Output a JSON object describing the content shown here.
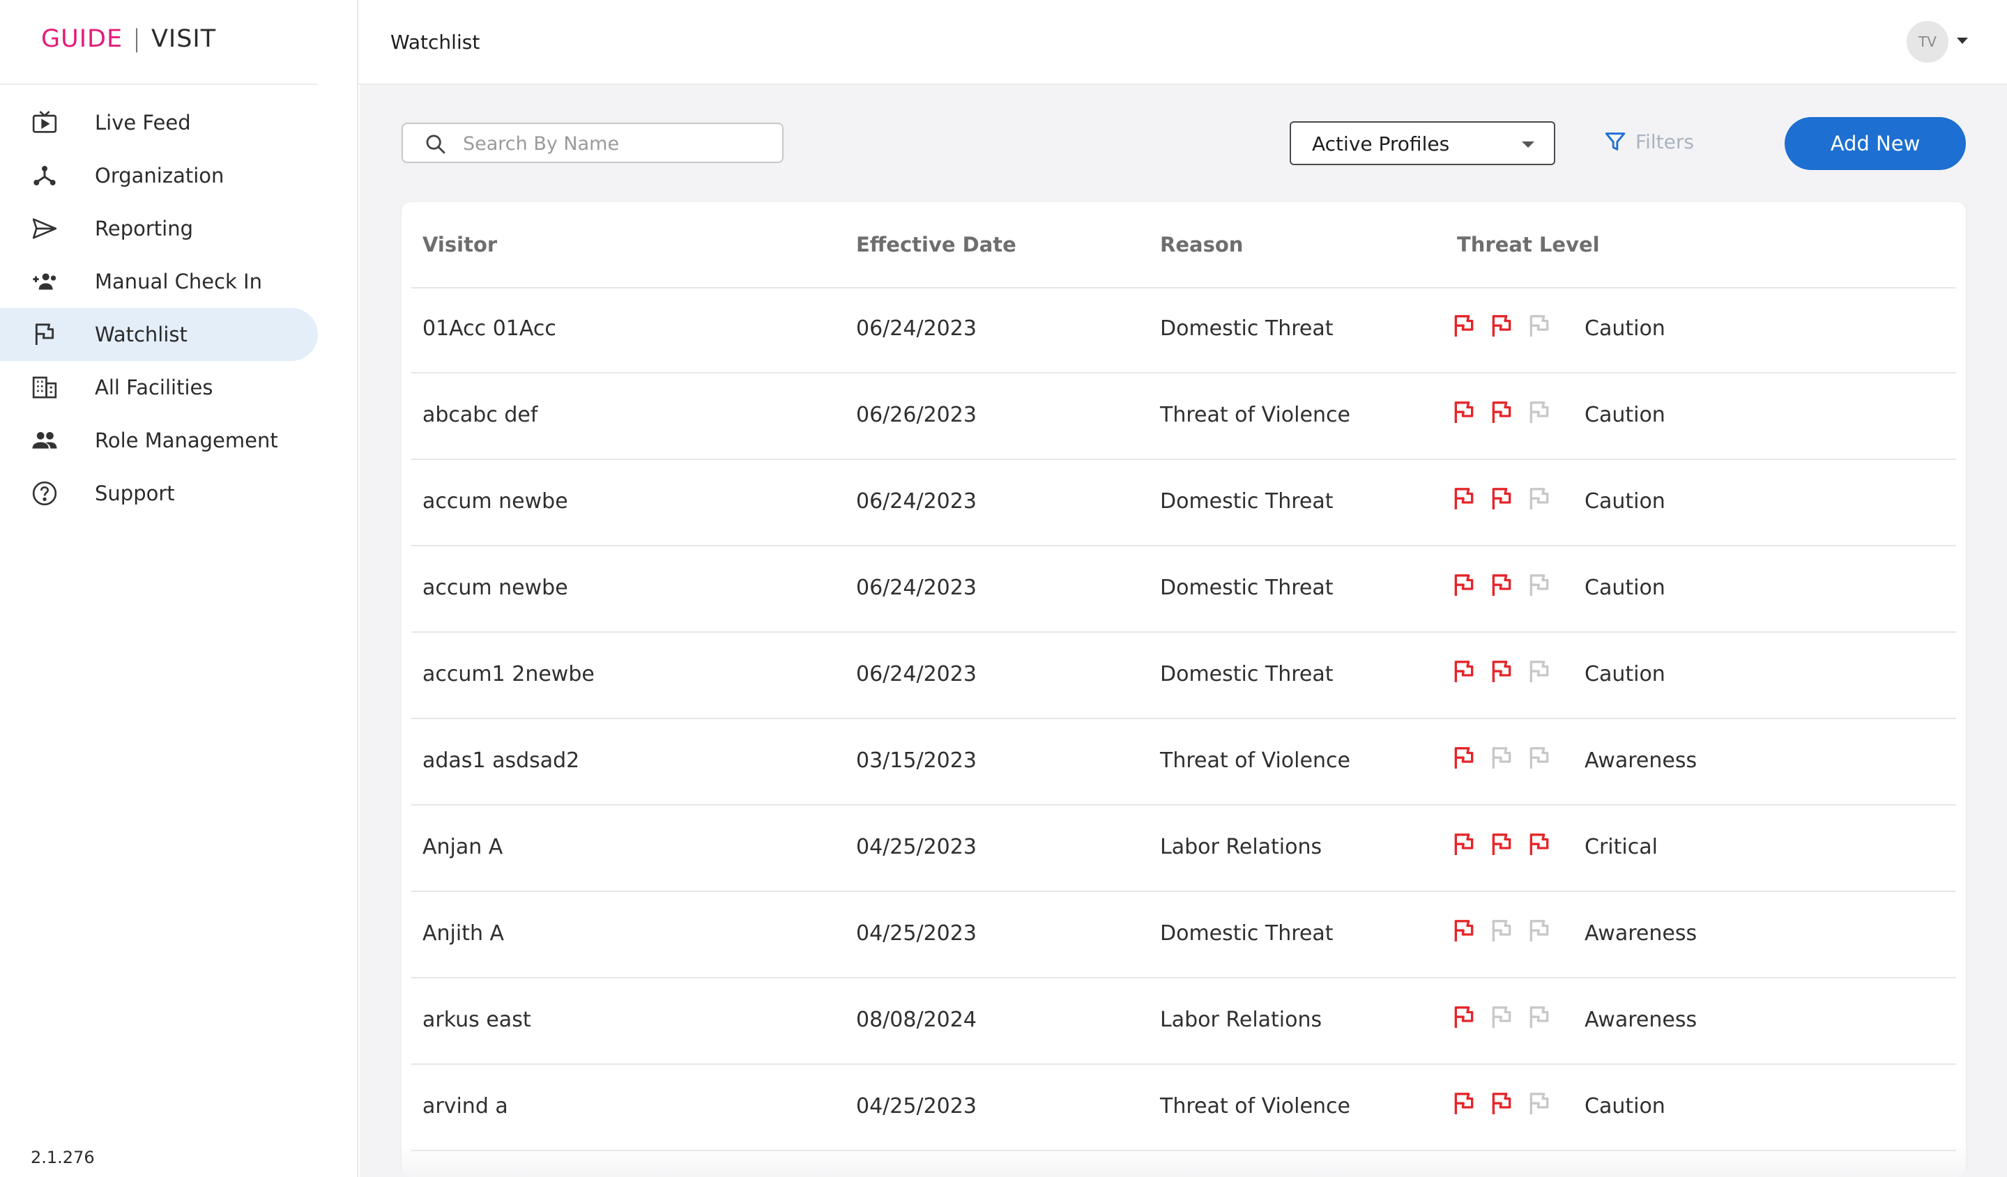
{
  "app": {
    "logo_left": "GUIDE",
    "logo_separator": "|",
    "logo_right": "VISIT",
    "brand_color": "#e31c79",
    "version": "2.1.276"
  },
  "sidebar": {
    "items": [
      {
        "label": "Live Feed",
        "icon": "live-feed-icon",
        "active": false
      },
      {
        "label": "Organization",
        "icon": "organization-icon",
        "active": false
      },
      {
        "label": "Reporting",
        "icon": "send-icon",
        "active": false
      },
      {
        "label": "Manual Check In",
        "icon": "group-add-icon",
        "active": false
      },
      {
        "label": "Watchlist",
        "icon": "flag-icon",
        "active": true
      },
      {
        "label": "All Facilities",
        "icon": "building-icon",
        "active": false
      },
      {
        "label": "Role Management",
        "icon": "people-icon",
        "active": false
      },
      {
        "label": "Support",
        "icon": "help-icon",
        "active": false
      }
    ]
  },
  "header": {
    "title": "Watchlist",
    "avatar_initials": "TV"
  },
  "toolbar": {
    "search_placeholder": "Search By Name",
    "profile_filter": "Active Profiles",
    "filters_label": "Filters",
    "add_new_label": "Add New",
    "accent_color": "#1d6fd1"
  },
  "table": {
    "columns": [
      "Visitor",
      "Effective Date",
      "Reason",
      "Threat Level"
    ],
    "rows": [
      {
        "visitor": "01Acc 01Acc",
        "date": "06/24/2023",
        "reason": "Domestic Threat",
        "flags": 2,
        "level": "Caution"
      },
      {
        "visitor": "abcabc def",
        "date": "06/26/2023",
        "reason": "Threat of Violence",
        "flags": 2,
        "level": "Caution"
      },
      {
        "visitor": "accum newbe",
        "date": "06/24/2023",
        "reason": "Domestic Threat",
        "flags": 2,
        "level": "Caution"
      },
      {
        "visitor": "accum newbe",
        "date": "06/24/2023",
        "reason": "Domestic Threat",
        "flags": 2,
        "level": "Caution"
      },
      {
        "visitor": "accum1 2newbe",
        "date": "06/24/2023",
        "reason": "Domestic Threat",
        "flags": 2,
        "level": "Caution"
      },
      {
        "visitor": "adas1 asdsad2",
        "date": "03/15/2023",
        "reason": "Threat of Violence",
        "flags": 1,
        "level": "Awareness"
      },
      {
        "visitor": "Anjan A",
        "date": "04/25/2023",
        "reason": "Labor Relations",
        "flags": 3,
        "level": "Critical"
      },
      {
        "visitor": "Anjith A",
        "date": "04/25/2023",
        "reason": "Domestic Threat",
        "flags": 1,
        "level": "Awareness"
      },
      {
        "visitor": "arkus east",
        "date": "08/08/2024",
        "reason": "Labor Relations",
        "flags": 1,
        "level": "Awareness"
      },
      {
        "visitor": "arvind a",
        "date": "04/25/2023",
        "reason": "Threat of Violence",
        "flags": 2,
        "level": "Caution"
      }
    ],
    "flag_active_color": "#e5252a",
    "flag_inactive_color": "#c8c8c8"
  }
}
